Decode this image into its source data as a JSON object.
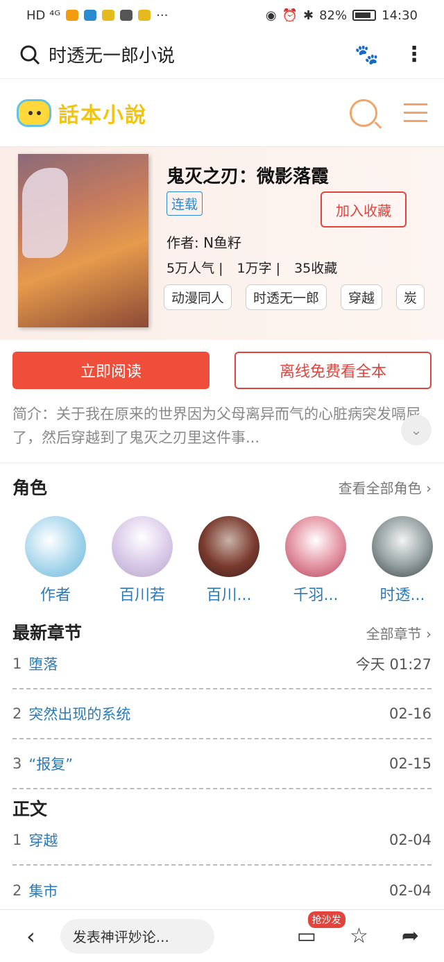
{
  "status_bar": {
    "left_text": "HD ⁴ᴳ",
    "battery": "82%",
    "time": "14:30"
  },
  "browser": {
    "query": "时透无一郎小说"
  },
  "site": {
    "logo_text": "話本小說"
  },
  "book": {
    "title": "鬼灭之刃：微影落霞",
    "status": "连载",
    "favorite_button": "加入收藏",
    "author": "作者: N鱼籽",
    "stats": [
      "5万人气 |",
      "1万字 |",
      "35收藏"
    ],
    "tags": [
      "动漫同人",
      "时透无一郎",
      "穿越",
      "炭"
    ]
  },
  "actions": {
    "read": "立即阅读",
    "offline": "离线免费看全本"
  },
  "intro": "简介：关于我在原来的世界因为父母离异而气的心脏病突发嗝屁了，然后穿越到了鬼灭之刃里这件事...",
  "roles_section": {
    "title": "角色",
    "link": "查看全部角色 ›",
    "roles": [
      {
        "name": "作者",
        "color": "#9fd2ea"
      },
      {
        "name": "百川若",
        "color": "#d9c9e8"
      },
      {
        "name": "百川...",
        "color": "#7a3a2e"
      },
      {
        "name": "千羽...",
        "color": "#e59aa8"
      },
      {
        "name": "时透...",
        "color": "#5a6b6e"
      }
    ]
  },
  "latest": {
    "title": "最新章节",
    "link": "全部章节 ›",
    "chapters": [
      {
        "num": "1",
        "name": "堕落",
        "date": "今天 01:27"
      },
      {
        "num": "2",
        "name": "突然出现的系统",
        "date": "02-16"
      },
      {
        "num": "3",
        "name": "“报复”",
        "date": "02-15"
      }
    ]
  },
  "main_text": {
    "title": "正文",
    "chapters": [
      {
        "num": "1",
        "name": "穿越",
        "date": "02-04"
      },
      {
        "num": "2",
        "name": "集市",
        "date": "02-04"
      }
    ]
  },
  "bottom_bar": {
    "comment_placeholder": "发表神评妙论...",
    "sofa_badge": "抢沙发"
  }
}
